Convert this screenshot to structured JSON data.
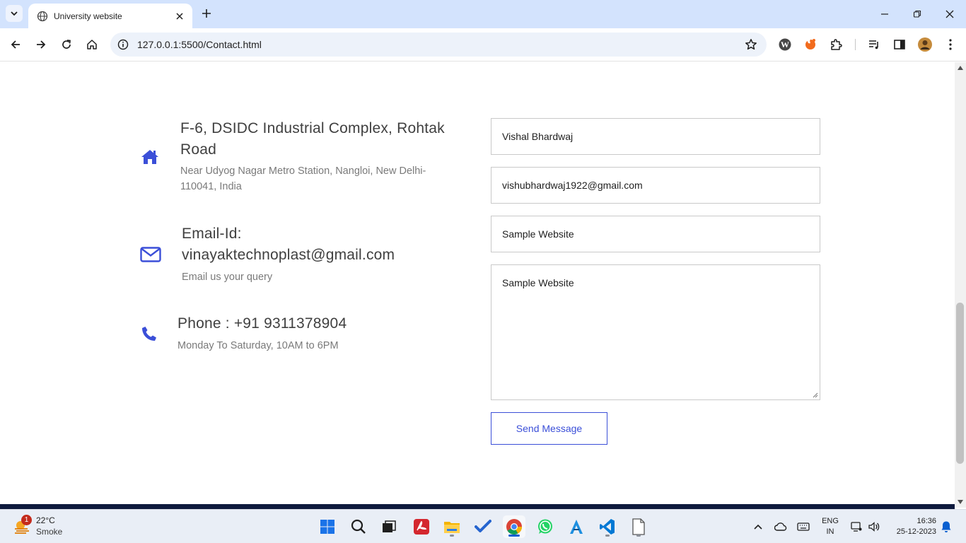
{
  "browser": {
    "tab_title": "University website",
    "url": "127.0.0.1:5500/Contact.html"
  },
  "contact": {
    "address": {
      "icon": "home-icon",
      "title": "F-6, DSIDC Industrial Complex, Rohtak Road",
      "subtitle": "Near Udyog Nagar Metro Station, Nangloi, New Delhi-110041, India"
    },
    "email": {
      "icon": "envelope-icon",
      "title": "Email-Id: vinayaktechnoplast@gmail.com",
      "subtitle": "Email us your query"
    },
    "phone": {
      "icon": "phone-icon",
      "title": "Phone : +91 9311378904",
      "subtitle": "Monday To Saturday, 10AM to 6PM"
    }
  },
  "form": {
    "name_value": "Vishal Bhardwaj",
    "email_value": "vishubhardwaj1922@gmail.com",
    "subject_value": "Sample Website",
    "message_value": "Sample Website",
    "send_label": "Send Message"
  },
  "colors": {
    "accent": "#3b4fd8",
    "tabbar": "#d3e3fd",
    "footer": "#0e1a3d"
  },
  "taskbar": {
    "weather_badge": "1",
    "temperature": "22°C",
    "weather": "Smoke",
    "lang_line1": "ENG",
    "lang_line2": "IN",
    "time": "16:36",
    "date": "25-12-2023"
  }
}
